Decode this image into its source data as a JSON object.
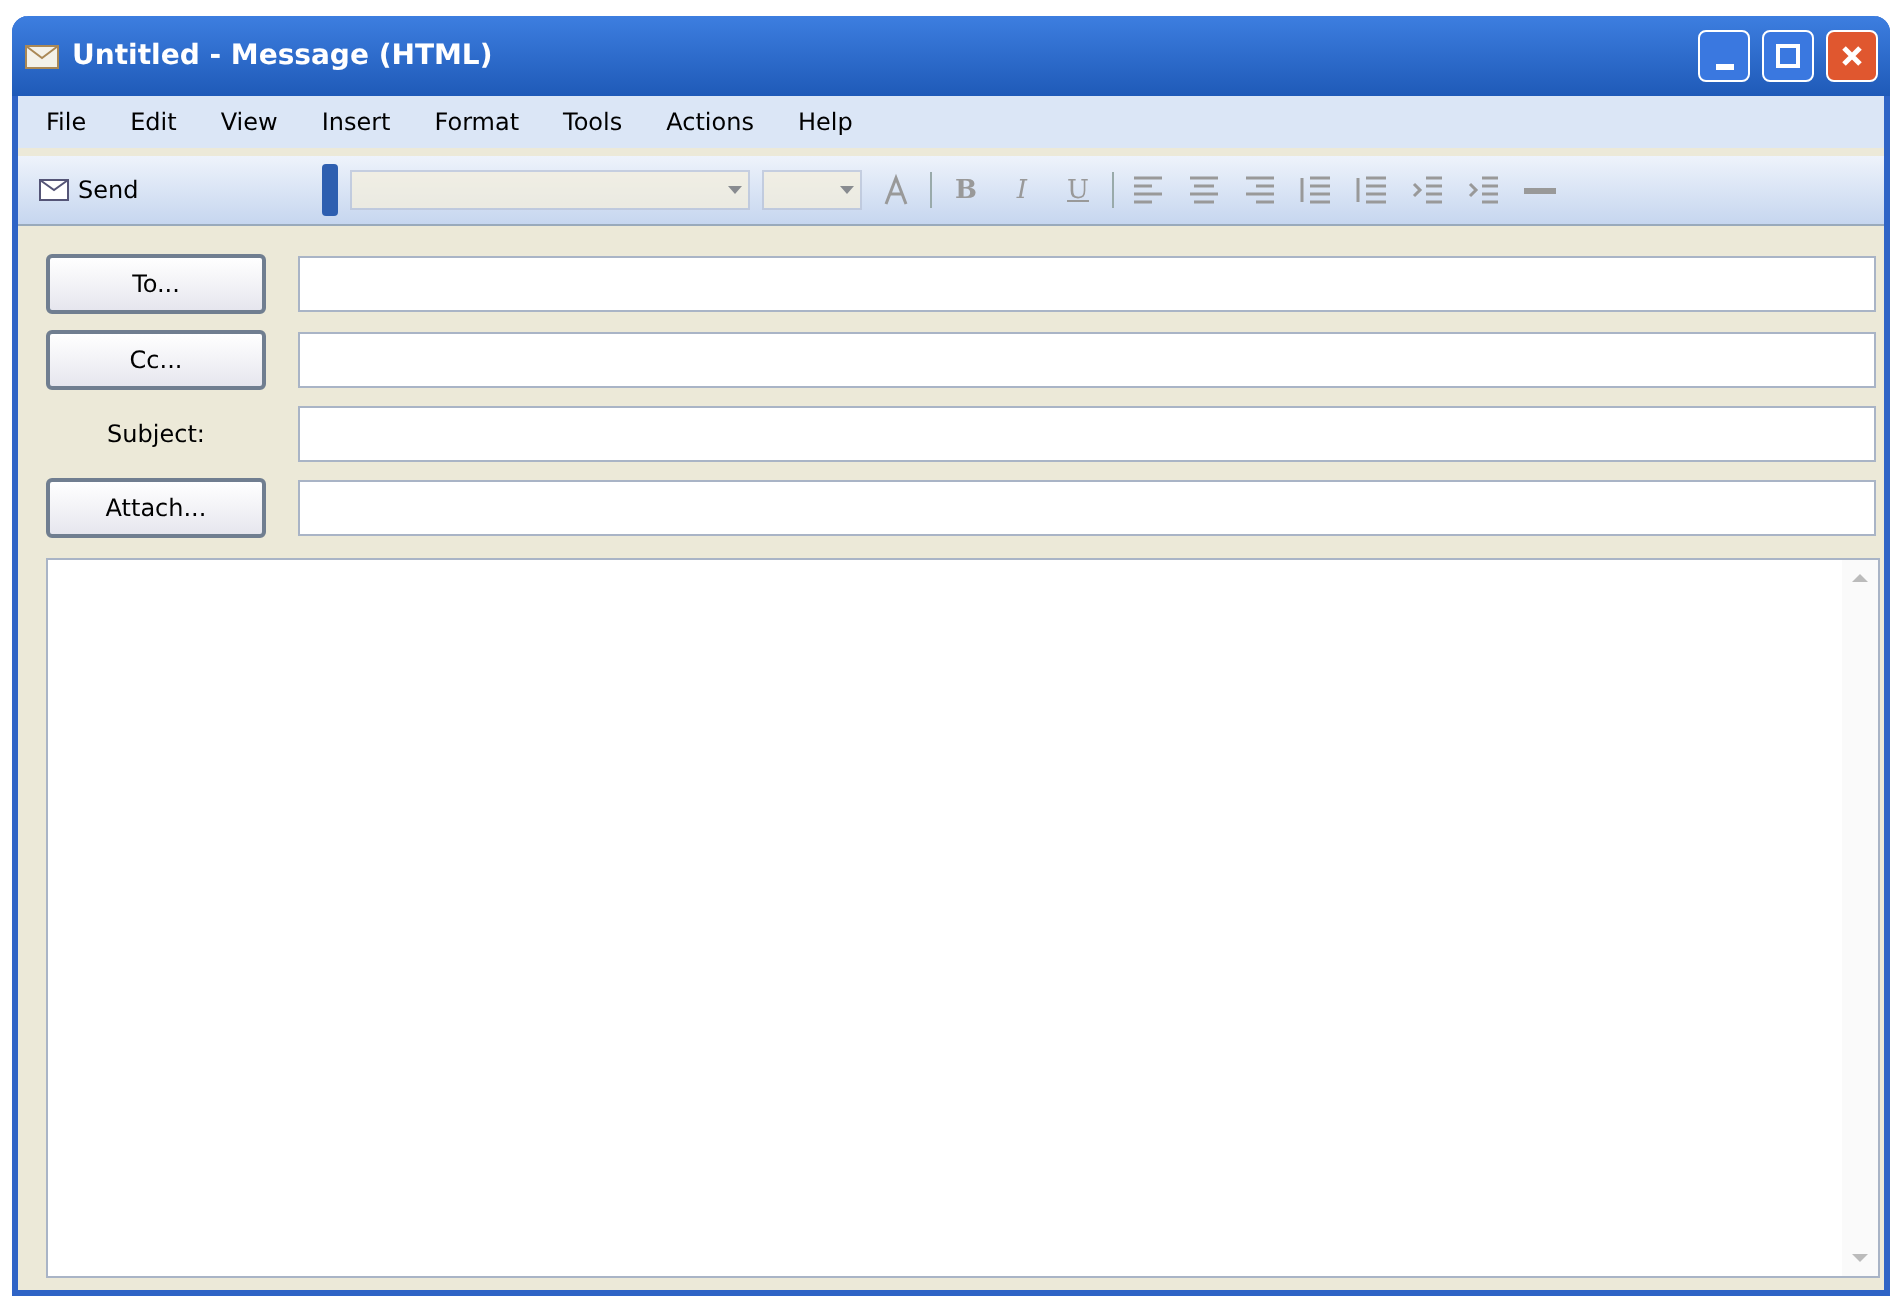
{
  "window": {
    "title": "Untitled - Message (HTML)"
  },
  "menu": [
    "File",
    "Edit",
    "View",
    "Insert",
    "Format",
    "Tools",
    "Actions",
    "Help"
  ],
  "toolbar": {
    "send": "Send",
    "font_combo": {
      "disabled": true
    },
    "size_combo": {
      "disabled": true
    },
    "format_buttons": [
      {
        "kind": "color",
        "disabled": true
      },
      {
        "kind": "sep"
      },
      {
        "kind": "text",
        "label": "B",
        "disabled": true
      },
      {
        "kind": "text",
        "label": "I",
        "disabled": true
      },
      {
        "kind": "text",
        "label": "U",
        "disabled": true
      },
      {
        "kind": "sep"
      },
      {
        "kind": "align-left",
        "disabled": true
      },
      {
        "kind": "align-center",
        "disabled": true
      },
      {
        "kind": "align-right",
        "disabled": true
      },
      {
        "kind": "numbered",
        "disabled": true
      },
      {
        "kind": "bullets",
        "disabled": true
      },
      {
        "kind": "outdent",
        "disabled": true
      },
      {
        "kind": "indent",
        "disabled": true
      },
      {
        "kind": "rule",
        "disabled": true
      }
    ]
  },
  "fields": [
    {
      "kind": "button",
      "label": "To..."
    },
    {
      "kind": "button",
      "label": "Cc..."
    },
    {
      "kind": "label",
      "label": "Subject:"
    },
    {
      "kind": "button",
      "label": "Attach..."
    }
  ]
}
